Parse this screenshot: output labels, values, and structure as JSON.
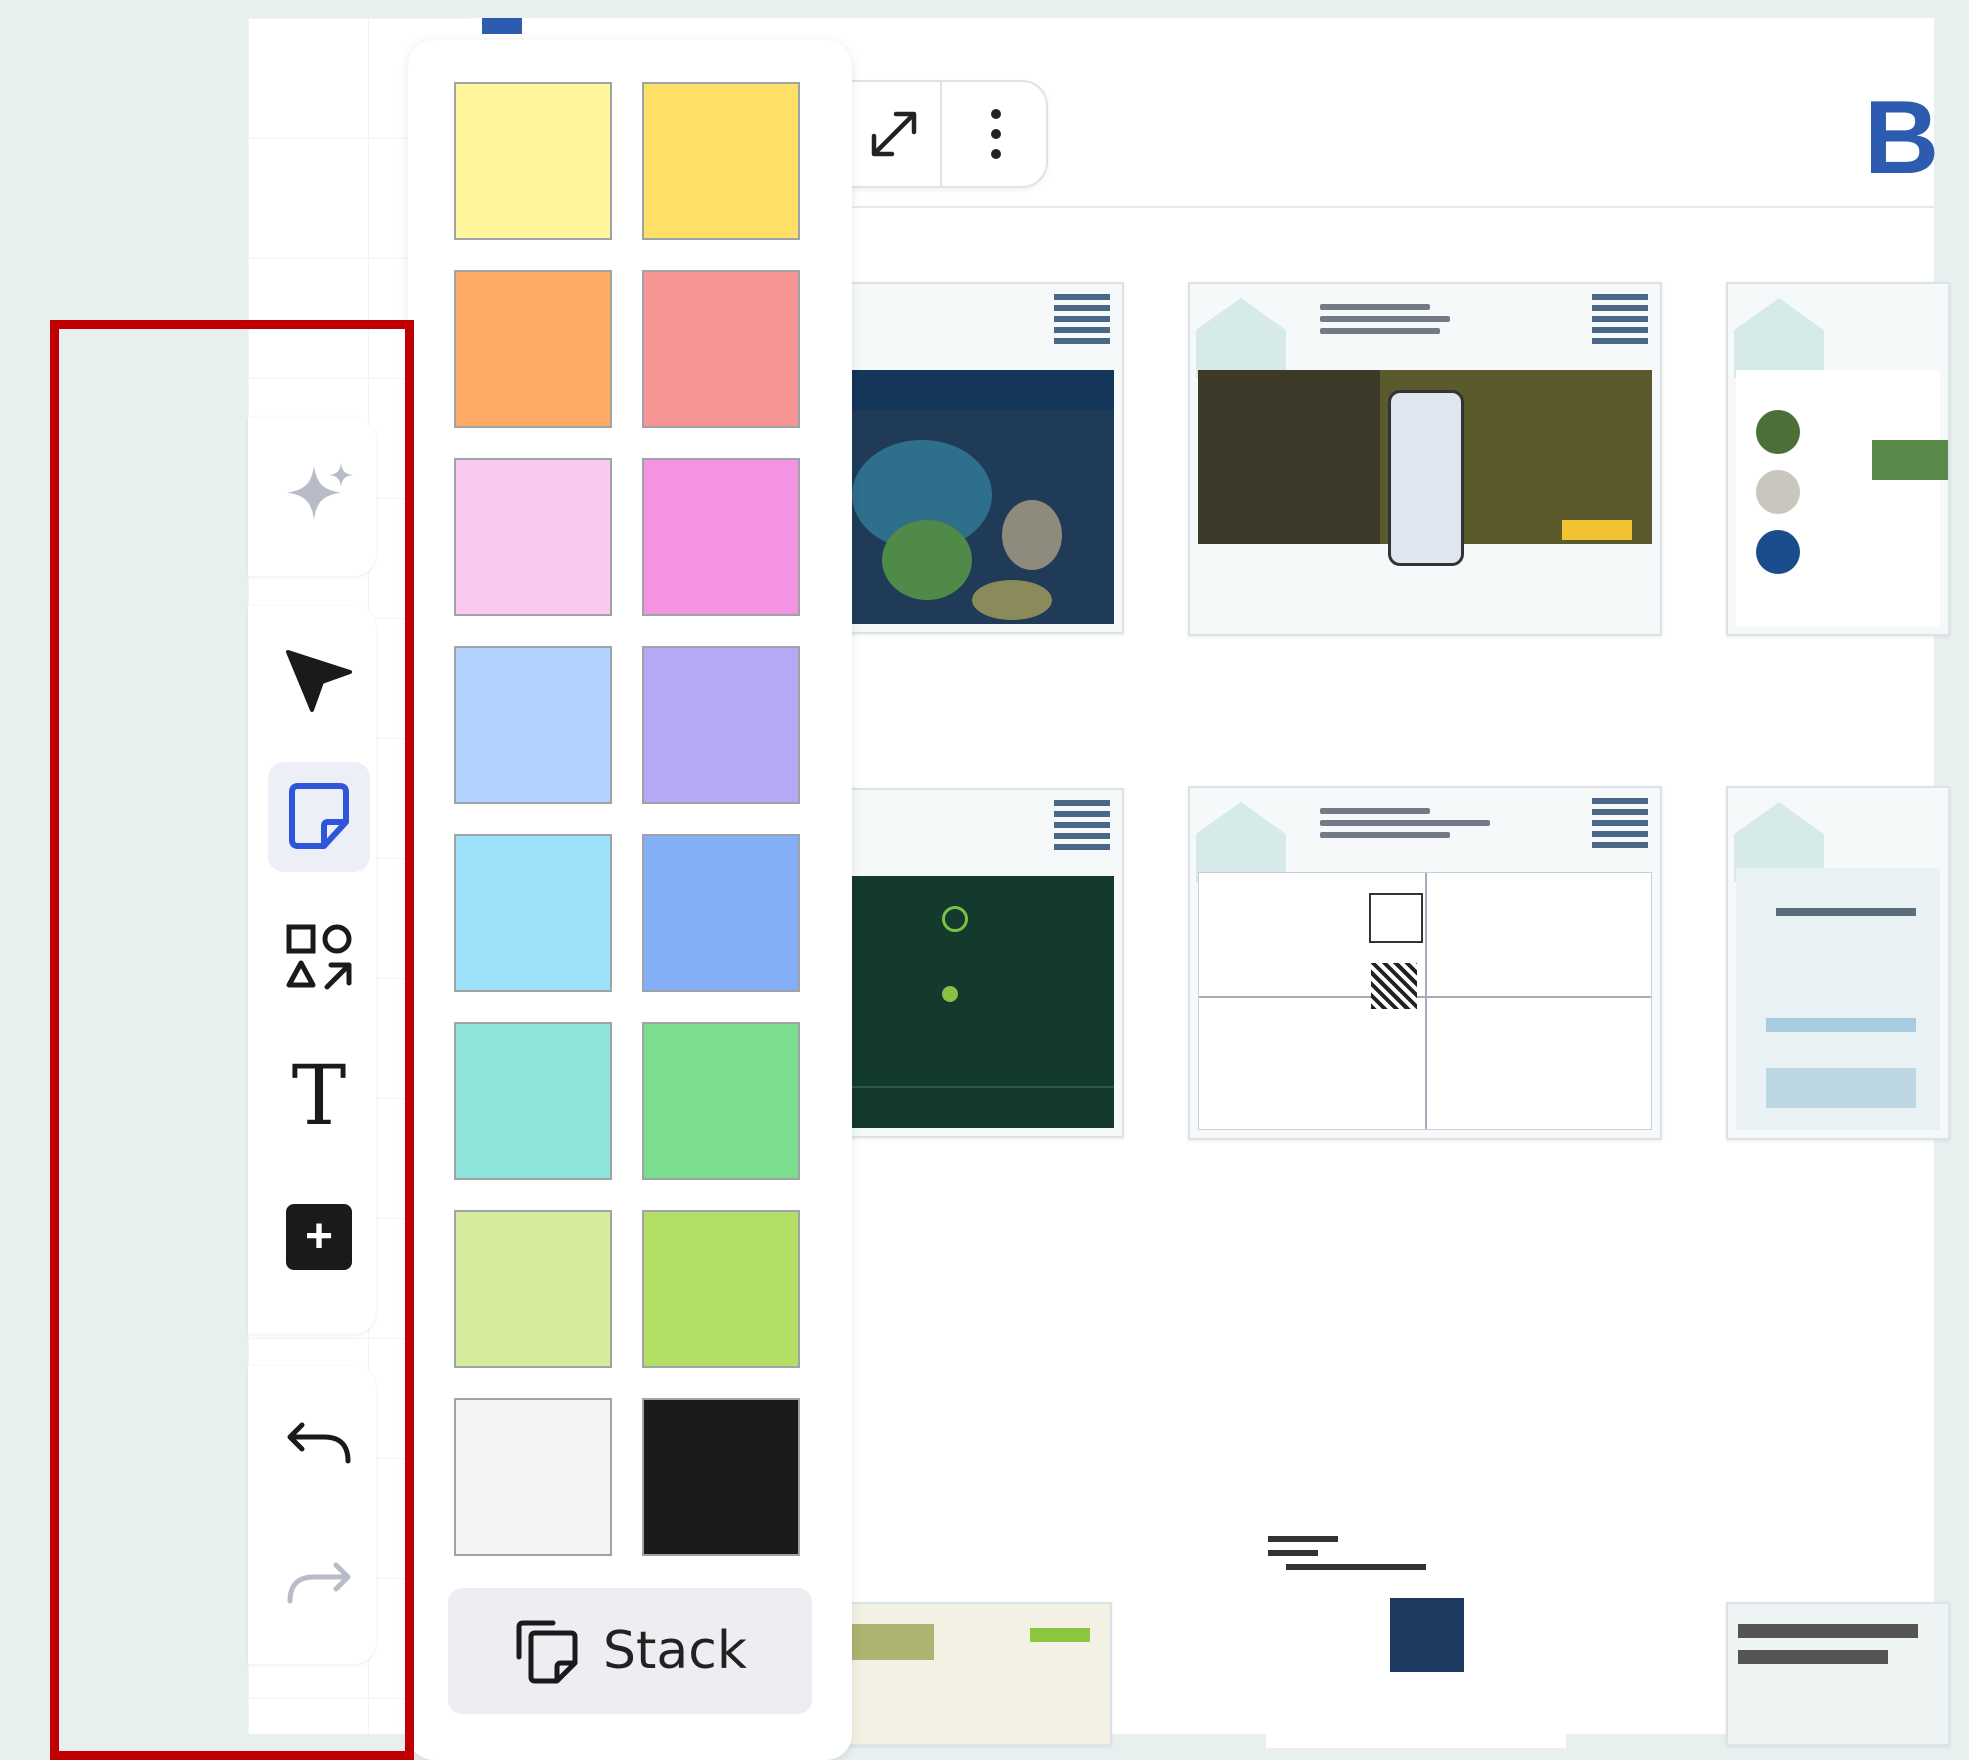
{
  "toolbar": {
    "items": [
      {
        "name": "ai-sparkle",
        "icon": "sparkle-icon"
      },
      {
        "name": "select",
        "icon": "cursor-arrow-icon"
      },
      {
        "name": "sticky-note",
        "icon": "sticky-note-icon",
        "active": true
      },
      {
        "name": "shapes",
        "icon": "shapes-icon"
      },
      {
        "name": "text",
        "icon": "text-icon",
        "glyph": "T"
      },
      {
        "name": "add",
        "icon": "plus-square-icon",
        "glyph": "+"
      },
      {
        "name": "undo",
        "icon": "undo-icon"
      },
      {
        "name": "redo",
        "icon": "redo-icon"
      }
    ]
  },
  "palette": {
    "colors": [
      "#fff59a",
      "#ffe066",
      "#fdab66",
      "#f79494",
      "#fbc9ef",
      "#f593e3",
      "#b3d2fd",
      "#b5a8f5",
      "#9ee1fb",
      "#84aef5",
      "#8fe5d9",
      "#7bdd8e",
      "#d5ec9c",
      "#b3df66",
      "#f3f4f6",
      "#1b1b1b"
    ],
    "stack_label": "Stack"
  },
  "board": {
    "header_letter": "B"
  },
  "accent": "#2d5bb0",
  "highlight_color": "#c00000"
}
